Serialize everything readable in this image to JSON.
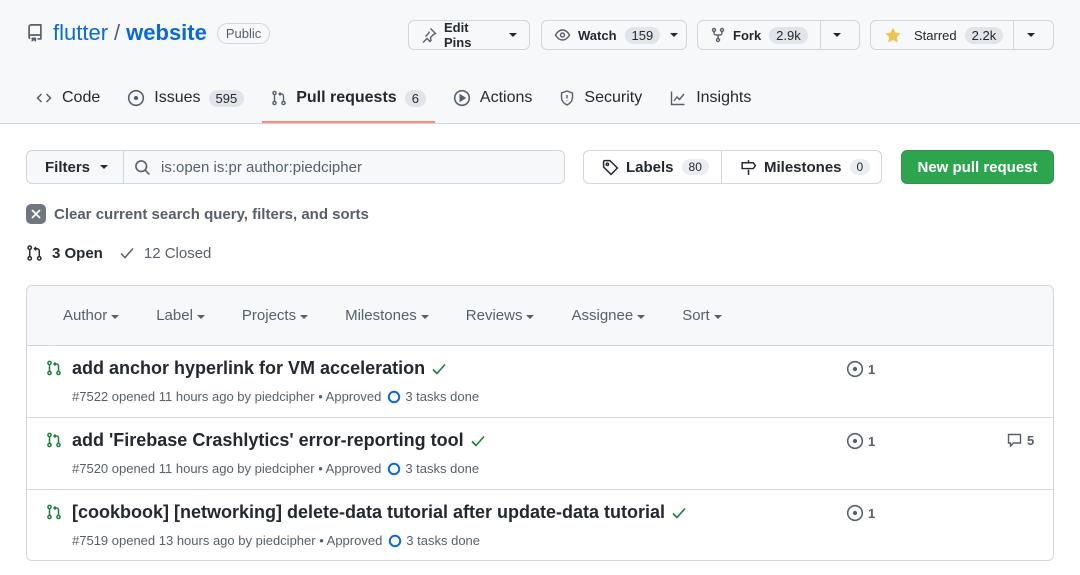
{
  "repo": {
    "owner": "flutter",
    "sep": "/",
    "name": "website",
    "visibility": "Public"
  },
  "header_buttons": {
    "edit_pins": "Edit Pins",
    "watch": "Watch",
    "watch_count": "159",
    "fork": "Fork",
    "fork_count": "2.9k",
    "starred": "Starred",
    "star_count": "2.2k"
  },
  "tabs": [
    {
      "label": "Code",
      "count": ""
    },
    {
      "label": "Issues",
      "count": "595"
    },
    {
      "label": "Pull requests",
      "count": "6"
    },
    {
      "label": "Actions",
      "count": ""
    },
    {
      "label": "Security",
      "count": ""
    },
    {
      "label": "Insights",
      "count": ""
    }
  ],
  "filters": {
    "button": "Filters",
    "query": "is:open is:pr author:piedcipher",
    "labels": "Labels",
    "labels_count": "80",
    "milestones": "Milestones",
    "milestones_count": "0",
    "new_pr": "New pull request",
    "clear": "Clear current search query, filters, and sorts"
  },
  "state": {
    "open": "3 Open",
    "closed": "12 Closed"
  },
  "list_header": [
    "Author",
    "Label",
    "Projects",
    "Milestones",
    "Reviews",
    "Assignee",
    "Sort"
  ],
  "pull_requests": [
    {
      "title": "add anchor hyperlink for VM acceleration",
      "meta": "#7522 opened 11 hours ago by piedcipher • Approved",
      "tasks": "3 tasks done",
      "linked": "1",
      "comments": ""
    },
    {
      "title": "add 'Firebase Crashlytics' error-reporting tool",
      "meta": "#7520 opened 11 hours ago by piedcipher • Approved",
      "tasks": "3 tasks done",
      "linked": "1",
      "comments": "5"
    },
    {
      "title": "[cookbook] [networking] delete-data tutorial after update-data tutorial",
      "meta": "#7519 opened 13 hours ago by piedcipher • Approved",
      "tasks": "3 tasks done",
      "linked": "1",
      "comments": ""
    }
  ],
  "colors": {
    "accent": "#0969da",
    "primary_button": "#2da44e",
    "open_green": "#1a7f37",
    "tab_underline": "#fd8c73",
    "star": "#eac54f"
  }
}
